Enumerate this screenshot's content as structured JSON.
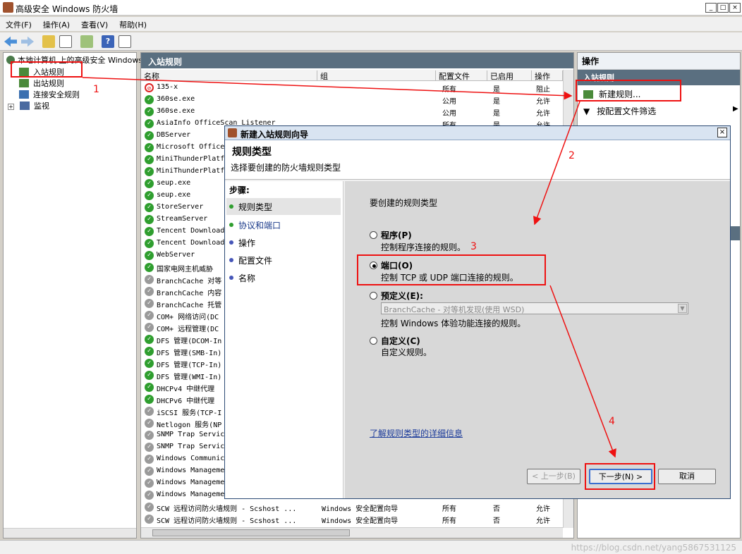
{
  "window": {
    "title": "高级安全 Windows 防火墙"
  },
  "menu": [
    "文件(F)",
    "操作(A)",
    "查看(V)",
    "帮助(H)"
  ],
  "tree": {
    "root": "本地计算机 上的高级安全 Windows",
    "inbound": "入站规则",
    "outbound": "出站规则",
    "conn": "连接安全规则",
    "monitor": "监视"
  },
  "center": {
    "header": "入站规则",
    "cols": {
      "name": "名称",
      "group": "组",
      "profile": "配置文件",
      "enabled": "已启用",
      "action": "操作"
    }
  },
  "rules": [
    {
      "name": "135-x",
      "group": "",
      "profile": "所有",
      "enabled": "是",
      "action": "阻止",
      "state": "blk"
    },
    {
      "name": "360se.exe",
      "group": "",
      "profile": "公用",
      "enabled": "是",
      "action": "允许",
      "state": "on"
    },
    {
      "name": "360se.exe",
      "group": "",
      "profile": "公用",
      "enabled": "是",
      "action": "允许",
      "state": "on"
    },
    {
      "name": "AsiaInfo OfficeScan Listener",
      "group": "",
      "profile": "所有",
      "enabled": "是",
      "action": "允许",
      "state": "on"
    },
    {
      "name": "DBServer",
      "state": "on"
    },
    {
      "name": "Microsoft Office",
      "state": "on"
    },
    {
      "name": "MiniThunderPlatf",
      "state": "on"
    },
    {
      "name": "MiniThunderPlatf",
      "state": "on"
    },
    {
      "name": "seup.exe",
      "state": "on"
    },
    {
      "name": "seup.exe",
      "state": "on"
    },
    {
      "name": "StoreServer",
      "state": "on"
    },
    {
      "name": "StreamServer",
      "state": "on"
    },
    {
      "name": "Tencent Download",
      "state": "on"
    },
    {
      "name": "Tencent Download",
      "state": "on"
    },
    {
      "name": "WebServer",
      "state": "on"
    },
    {
      "name": "国家电网主机威胁",
      "state": "on"
    },
    {
      "name": "BranchCache 对等",
      "state": "off"
    },
    {
      "name": "BranchCache 内容",
      "state": "off"
    },
    {
      "name": "BranchCache 托管",
      "state": "off"
    },
    {
      "name": "COM+ 网络访问(DC",
      "state": "off"
    },
    {
      "name": "COM+ 远程管理(DC",
      "state": "off"
    },
    {
      "name": "DFS 管理(DCOM-In",
      "state": "on"
    },
    {
      "name": "DFS 管理(SMB-In)",
      "state": "on"
    },
    {
      "name": "DFS 管理(TCP-In)",
      "state": "on"
    },
    {
      "name": "DFS 管理(WMI-In)",
      "state": "on"
    },
    {
      "name": "DHCPv4 中继代理",
      "state": "on"
    },
    {
      "name": "DHCPv6 中继代理",
      "state": "on"
    },
    {
      "name": "iSCSI 服务(TCP-I",
      "state": "off"
    },
    {
      "name": "Netlogon 服务(NP",
      "state": "off"
    },
    {
      "name": "SNMP Trap Servic",
      "state": "off"
    },
    {
      "name": "SNMP Trap Servic",
      "state": "off"
    },
    {
      "name": "Windows Communic",
      "state": "off"
    },
    {
      "name": "Windows Manageme",
      "state": "off"
    },
    {
      "name": "Windows Manageme",
      "state": "off"
    },
    {
      "name": "Windows Manageme",
      "state": "off"
    },
    {
      "name": "SCW 远程访问防火墙规则 - Scshost ...",
      "group": "Windows 安全配置向导",
      "profile": "所有",
      "enabled": "否",
      "action": "允许",
      "state": "off"
    },
    {
      "name": "SCW 远程访问防火墙规则 - Scshost ...",
      "group": "Windows 安全配置向导",
      "profile": "所有",
      "enabled": "否",
      "action": "允许",
      "state": "off"
    }
  ],
  "actions": {
    "header": "操作",
    "sub": "入站规则",
    "new_rule": "新建规则...",
    "filter_profile": "按配置文件筛选"
  },
  "dialog": {
    "title": "新建入站规则向导",
    "heading": "规则类型",
    "subheading": "选择要创建的防火墙规则类型",
    "steps_label": "步骤:",
    "steps": [
      "规则类型",
      "协议和端口",
      "操作",
      "配置文件",
      "名称"
    ],
    "prompt": "要创建的规则类型",
    "opt_program": "程序(P)",
    "opt_program_desc": "控制程序连接的规则。",
    "opt_port": "端口(O)",
    "opt_port_desc": "控制 TCP 或 UDP 端口连接的规则。",
    "opt_predef": "预定义(E):",
    "predef_value": "BranchCache - 对等机发现(使用 WSD)",
    "opt_predef_desc": "控制 Windows 体验功能连接的规则。",
    "opt_custom": "自定义(C)",
    "opt_custom_desc": "自定义规则。",
    "learn_more": "了解规则类型的详细信息",
    "back": "< 上一步(B)",
    "next": "下一步(N) >",
    "cancel": "取消"
  },
  "annotations": [
    "1",
    "2",
    "3",
    "4"
  ],
  "watermark": "https://blog.csdn.net/yang5867531125",
  "colors": {
    "annotation": "#e11",
    "header_bg": "#5a6f80"
  }
}
